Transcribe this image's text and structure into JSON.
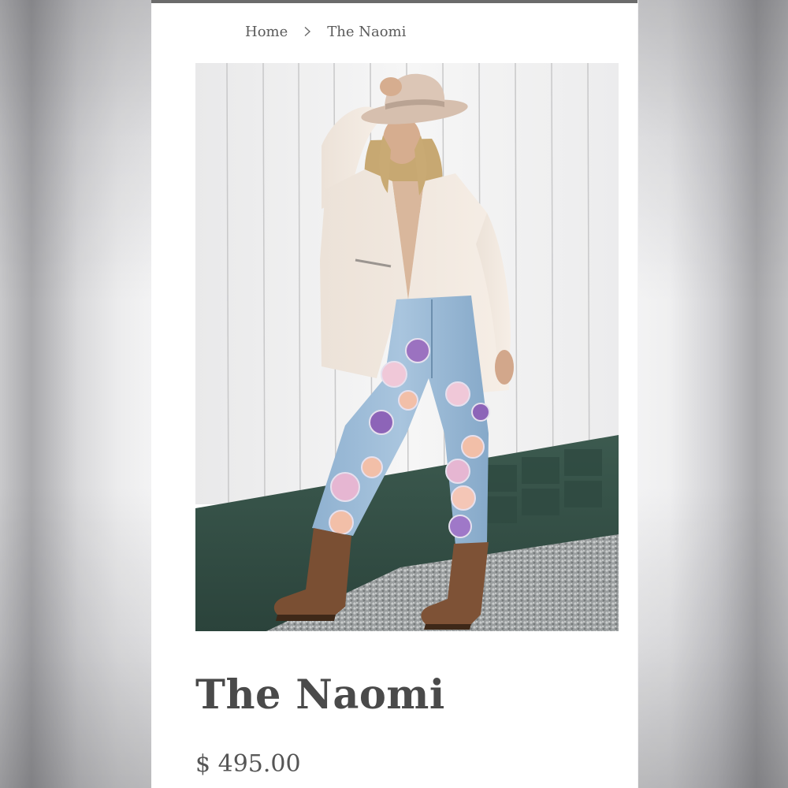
{
  "breadcrumb": {
    "home_label": "Home",
    "separator_icon": "chevron-right-icon",
    "current_label": "The Naomi"
  },
  "product": {
    "title": "The Naomi",
    "price": "$ 495.00",
    "image_alt": "Model in cream jacket, wide-brim hat, patched light-wash jeans and brown western boots against a white wooden wall"
  },
  "colors": {
    "page_background": "#ffffff",
    "top_bar": "#6b6b6b",
    "text_dark": "#4a4a4a",
    "text_muted": "#5b5b5b"
  }
}
